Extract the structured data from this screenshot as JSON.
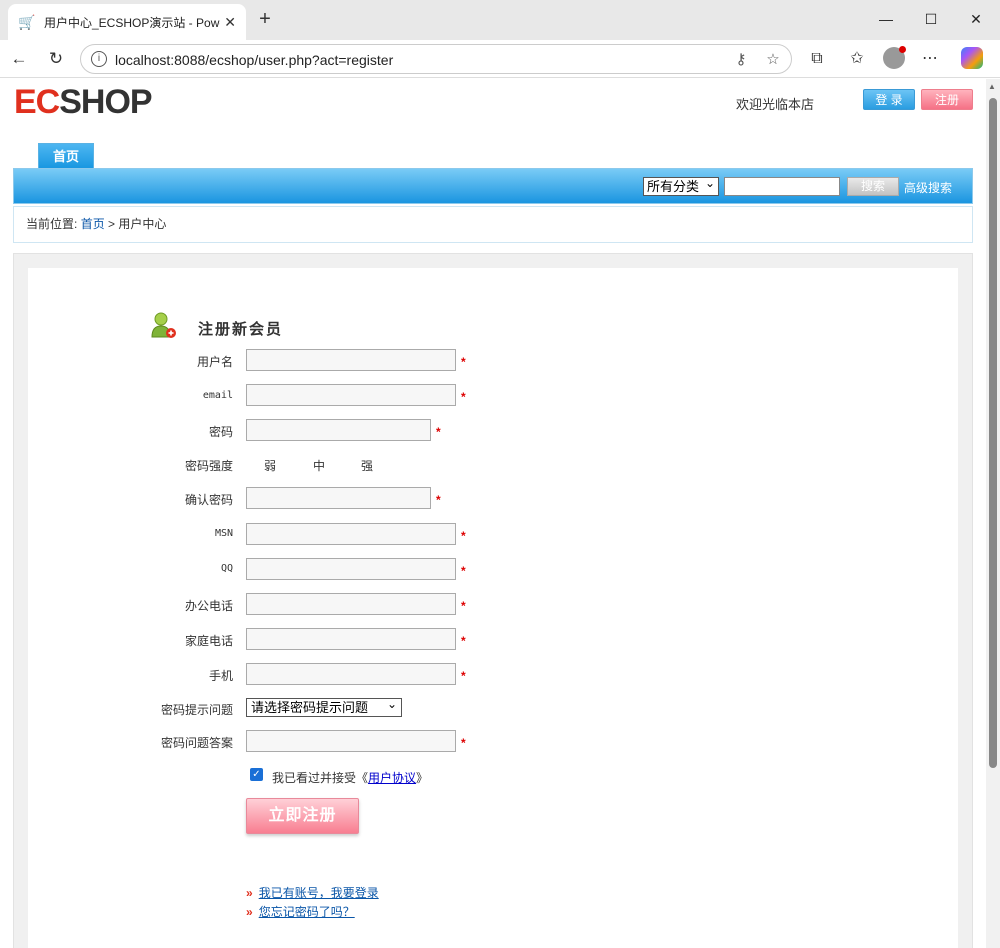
{
  "browser": {
    "tab_title": "用户中心_ECSHOP演示站 - Power",
    "url": "localhost:8088/ecshop/user.php?act=register"
  },
  "header": {
    "logo_ec": "EC",
    "logo_shop": "SHOP",
    "welcome": "欢迎光临本店",
    "login_label": "登 录",
    "register_label": "注册"
  },
  "nav": {
    "home_tab": "首页",
    "category_selected": "所有分类",
    "search_button": "搜索",
    "advanced_search": "高级搜索"
  },
  "breadcrumb": {
    "prefix": "当前位置:",
    "home": "首页",
    "separator": ">",
    "current": "用户中心"
  },
  "form": {
    "title": "注册新会员",
    "fields": {
      "username": "用户名",
      "email": "email",
      "password": "密码",
      "strength": "密码强度",
      "confirm": "确认密码",
      "msn": "MSN",
      "qq": "QQ",
      "office_phone": "办公电话",
      "home_phone": "家庭电话",
      "mobile": "手机",
      "question": "密码提示问题",
      "answer": "密码问题答案"
    },
    "strength_levels": [
      "弱",
      "中",
      "强"
    ],
    "required_mark": "*",
    "question_selected": "请选择密码提示问题",
    "agree_prefix": "我已看过并接受《",
    "agree_link": "用户协议",
    "agree_suffix": "》",
    "agree_checked": true,
    "submit": "立即注册",
    "link_login": "我已有账号，我要登录",
    "link_forgot": "您忘记密码了吗？"
  }
}
